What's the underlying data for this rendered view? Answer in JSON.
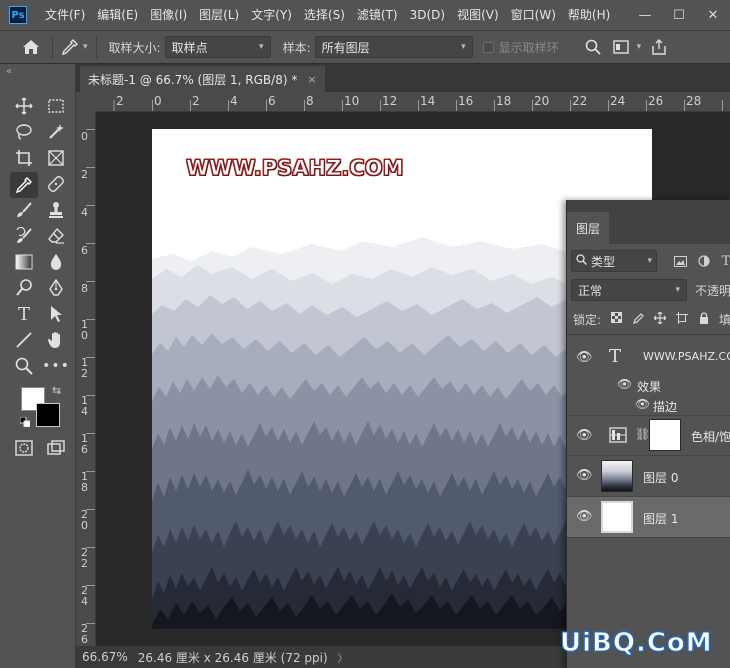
{
  "app": {
    "logo": "Ps",
    "menu": [
      "文件(F)",
      "编辑(E)",
      "图像(I)",
      "图层(L)",
      "文字(Y)",
      "选择(S)",
      "滤镜(T)",
      "3D(D)",
      "视图(V)",
      "窗口(W)",
      "帮助(H)"
    ],
    "window_controls": [
      "—",
      "☐",
      "✕"
    ]
  },
  "options": {
    "sample_size_label": "取样大小:",
    "sample_size_value": "取样点",
    "sample_label": "样本:",
    "sample_value": "所有图层",
    "show_ring_label": "显示取样环"
  },
  "document": {
    "tab_title": "未标题-1 @ 66.7% (图层 1, RGB/8) *",
    "close": "×"
  },
  "rulers": {
    "top": [
      "2",
      "0",
      "2",
      "4",
      "6",
      "8",
      "10",
      "12",
      "14",
      "16",
      "18",
      "20",
      "22",
      "24",
      "26",
      "28"
    ],
    "left": [
      "0",
      "2",
      "4",
      "6",
      "8",
      "1 0",
      "1 2",
      "1 4",
      "1 6",
      "1 8",
      "2 0",
      "2 2",
      "2 4",
      "2 6"
    ]
  },
  "canvas": {
    "watermark": "WWW.PSAHZ.COM"
  },
  "status": {
    "zoom": "66.67%",
    "info": "26.46 厘米 x 26.46 厘米 (72 ppi)",
    "chevron": "〉"
  },
  "layers_panel": {
    "tab": "图层",
    "filter": "类型",
    "blend_mode": "正常",
    "opacity_label": "不透明",
    "lock_label": "锁定:",
    "fill_label": "填",
    "layers": [
      {
        "name": "WWW.PSAHZ.COM",
        "type": "text"
      },
      {
        "name": "效果",
        "type": "effects"
      },
      {
        "name": "描边",
        "type": "effect"
      },
      {
        "name": "色相/饱",
        "type": "adjustment"
      },
      {
        "name": "图层 0",
        "type": "pixel"
      },
      {
        "name": "图层 1",
        "type": "pixel"
      }
    ]
  },
  "site_watermark": "UiBQ.CoM"
}
